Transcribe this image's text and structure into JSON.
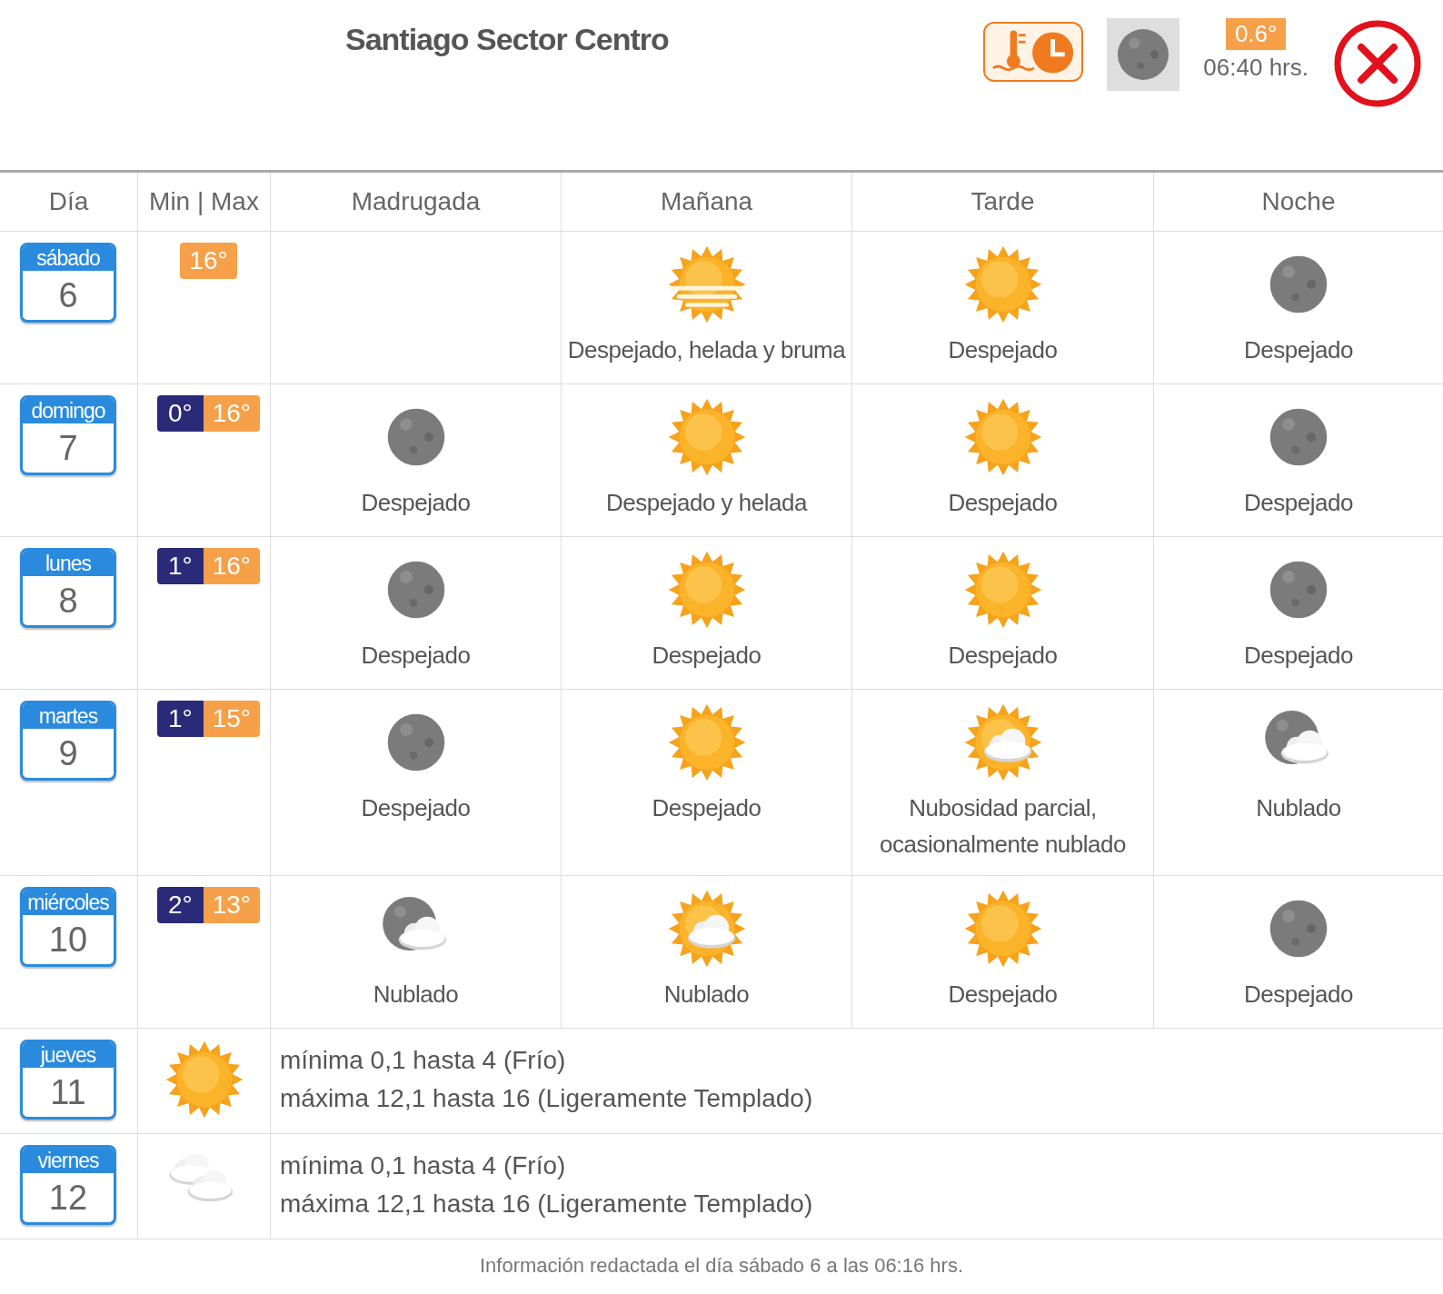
{
  "header": {
    "title": "Santiago Sector Centro",
    "current_temp": "0.6°",
    "time": "06:40 hrs."
  },
  "columns": [
    "Día",
    "Min | Max",
    "Madrugada",
    "Mañana",
    "Tarde",
    "Noche"
  ],
  "days": [
    {
      "kind": "periods",
      "weekday": "sábado",
      "date": "6",
      "max": "16°",
      "periods": [
        {
          "kind": "empty"
        },
        {
          "kind": "sun-fog",
          "text": "Despejado, helada y bruma"
        },
        {
          "kind": "sun",
          "text": "Despejado"
        },
        {
          "kind": "moon",
          "text": "Despejado"
        }
      ]
    },
    {
      "kind": "periods",
      "weekday": "domingo",
      "date": "7",
      "min": "0°",
      "max": "16°",
      "periods": [
        {
          "kind": "moon",
          "text": "Despejado"
        },
        {
          "kind": "sun",
          "text": "Despejado y helada"
        },
        {
          "kind": "sun",
          "text": "Despejado"
        },
        {
          "kind": "moon",
          "text": "Despejado"
        }
      ]
    },
    {
      "kind": "periods",
      "weekday": "lunes",
      "date": "8",
      "min": "1°",
      "max": "16°",
      "periods": [
        {
          "kind": "moon",
          "text": "Despejado"
        },
        {
          "kind": "sun",
          "text": "Despejado"
        },
        {
          "kind": "sun",
          "text": "Despejado"
        },
        {
          "kind": "moon",
          "text": "Despejado"
        }
      ]
    },
    {
      "kind": "periods",
      "weekday": "martes",
      "date": "9",
      "min": "1°",
      "max": "15°",
      "periods": [
        {
          "kind": "moon",
          "text": "Despejado"
        },
        {
          "kind": "sun",
          "text": "Despejado"
        },
        {
          "kind": "sun-cloud",
          "text": "Nubosidad parcial, ocasionalmente nublado"
        },
        {
          "kind": "moon-cloud",
          "text": "Nublado"
        }
      ]
    },
    {
      "kind": "periods",
      "weekday": "miércoles",
      "date": "10",
      "min": "2°",
      "max": "13°",
      "periods": [
        {
          "kind": "moon-cloud",
          "text": "Nublado"
        },
        {
          "kind": "sun-cloud",
          "text": "Nublado"
        },
        {
          "kind": "sun",
          "text": "Despejado"
        },
        {
          "kind": "moon",
          "text": "Despejado"
        }
      ]
    },
    {
      "kind": "summary",
      "weekday": "jueves",
      "date": "11",
      "weather": {
        "kind": "sun"
      },
      "lines": [
        "mínima 0,1 hasta 4 (Frío)",
        "máxima 12,1 hasta 16 (Ligeramente Templado)"
      ]
    },
    {
      "kind": "summary",
      "weekday": "viernes",
      "date": "12",
      "weather": {
        "kind": "clouds"
      },
      "lines": [
        "mínima 0,1 hasta 4 (Frío)",
        "máxima 12,1 hasta 16 (Ligeramente Templado)"
      ]
    }
  ],
  "footer": "Información redactada el día sábado 6 a las 06:16 hrs."
}
